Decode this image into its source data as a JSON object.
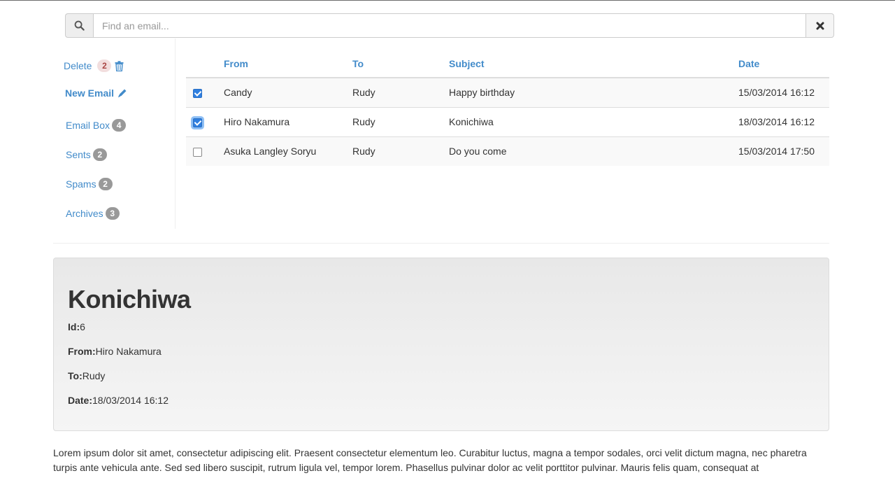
{
  "search": {
    "placeholder": "Find an email..."
  },
  "sidebar": {
    "delete": {
      "label": "Delete",
      "count": "2"
    },
    "new_email": {
      "label": "New Email"
    },
    "folders": [
      {
        "label": "Email Box",
        "count": "4"
      },
      {
        "label": "Sents",
        "count": "2"
      },
      {
        "label": "Spams",
        "count": "2"
      },
      {
        "label": "Archives",
        "count": "3"
      }
    ]
  },
  "table": {
    "headers": {
      "from": "From",
      "to": "To",
      "subject": "Subject",
      "date": "Date"
    },
    "rows": [
      {
        "checked": true,
        "from": "Candy",
        "to": "Rudy",
        "subject": "Happy birthday",
        "date": "15/03/2014 16:12"
      },
      {
        "checked": true,
        "from": "Hiro Nakamura",
        "to": "Rudy",
        "subject": "Konichiwa",
        "date": "18/03/2014 16:12"
      },
      {
        "checked": false,
        "from": "Asuka Langley Soryu",
        "to": "Rudy",
        "subject": "Do you come",
        "date": "15/03/2014 17:50"
      }
    ]
  },
  "detail": {
    "title": "Konichiwa",
    "id_label": "Id:",
    "id": "6",
    "from_label": "From:",
    "from": "Hiro Nakamura",
    "to_label": "To:",
    "to": "Rudy",
    "date_label": "Date:",
    "date": "18/03/2014 16:12",
    "body": "Lorem ipsum dolor sit amet, consectetur adipiscing elit. Praesent consectetur elementum leo. Curabitur luctus, magna a tempor sodales, orci velit dictum magna, nec pharetra turpis ante vehicula ante. Sed sed libero suscipit, rutrum ligula vel, tempor lorem. Phasellus pulvinar dolor ac velit porttitor pulvinar. Mauris felis quam, consequat at"
  },
  "colors": {
    "link": "#428bca",
    "badge": "#999999",
    "badge_danger_bg": "#f2dede",
    "badge_danger_text": "#a94442"
  },
  "icons": {
    "search": "search-icon",
    "clear": "close-icon",
    "delete": "trash-icon",
    "new_email": "pencil-icon"
  }
}
